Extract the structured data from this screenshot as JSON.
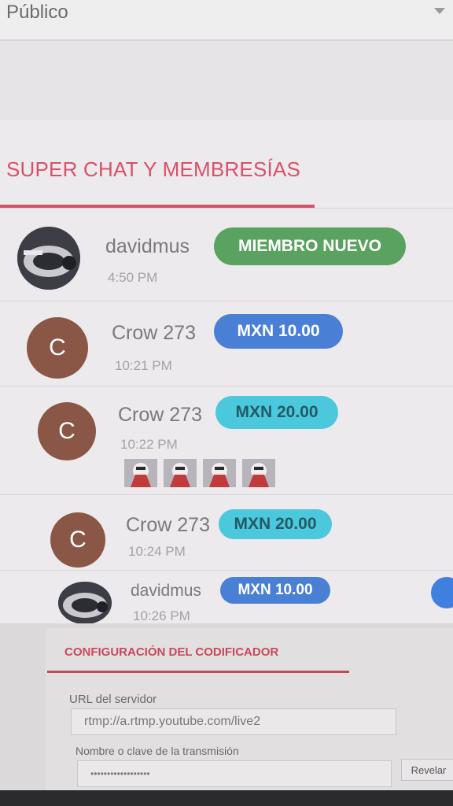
{
  "visibility": {
    "value": "Público",
    "caret_icon": "caret-down-icon"
  },
  "super_chat": {
    "title": "SUPER CHAT Y MEMBRESÍAS",
    "accent_color": "#d9506a",
    "items": [
      {
        "name": "davidmus",
        "badge": "MIEMBRO NUEVO",
        "badge_color": "#5aa25f",
        "time": "4:50 PM",
        "avatar_letter": "",
        "avatar_type": "photo"
      },
      {
        "name": "Crow 273",
        "badge": "MXN 10.00",
        "badge_color": "#4a7fd6",
        "time": "10:21 PM",
        "avatar_letter": "C",
        "avatar_type": "letter"
      },
      {
        "name": "Crow 273",
        "badge": "MXN 20.00",
        "badge_color": "#4cc8dc",
        "time": "10:22 PM",
        "avatar_letter": "C",
        "avatar_type": "letter",
        "emote_count": 4
      },
      {
        "name": "Crow 273",
        "badge": "MXN 20.00",
        "badge_color": "#4cc8dc",
        "time": "10:24 PM",
        "avatar_letter": "C",
        "avatar_type": "letter"
      },
      {
        "name": "davidmus",
        "badge": "MXN 10.00",
        "badge_color": "#4a7fd6",
        "time": "10:26 PM",
        "avatar_letter": "",
        "avatar_type": "photo"
      }
    ],
    "side_button_icon": "check-icon"
  },
  "encoder": {
    "title": "CONFIGURACIÓN DEL CODIFICADOR",
    "server_url_label": "URL del servidor",
    "server_url_value": "rtmp://a.rtmp.youtube.com/live2",
    "stream_key_label": "Nombre o clave de la transmisión",
    "stream_key_value": "••••••••••••••••••",
    "reveal_label": "Revelar"
  }
}
